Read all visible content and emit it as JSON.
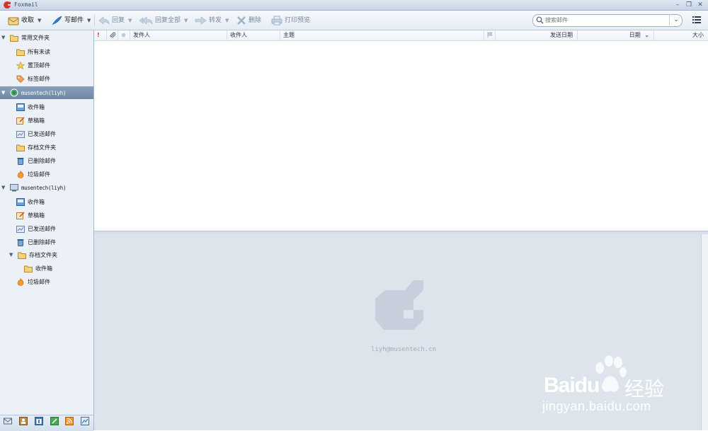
{
  "window": {
    "title": "Foxmail"
  },
  "toolbar": {
    "receive": "收取",
    "compose": "写邮件",
    "reply": "回复",
    "reply_all": "回复全部",
    "forward": "转发",
    "delete": "删除",
    "print_preview": "打印预览"
  },
  "search": {
    "placeholder": "搜索邮件"
  },
  "sidebar": {
    "common_group": {
      "label": "常用文件夹",
      "items": [
        "所有未读",
        "置顶邮件",
        "标签邮件"
      ]
    },
    "accounts": [
      {
        "label": "musentech(liyh)",
        "folders": [
          "收件箱",
          "草稿箱",
          "已发送邮件",
          "存档文件夹",
          "已删除邮件",
          "垃圾邮件"
        ]
      },
      {
        "label": "musentech(liyh)",
        "folders": [
          "收件箱",
          "草稿箱",
          "已发送邮件",
          "已删除邮件",
          "存档文件夹",
          "收件箱",
          "垃圾邮件"
        ]
      }
    ]
  },
  "list": {
    "columns": {
      "flag": "!",
      "sender": "发件人",
      "recipient": "收件人",
      "subject": "主题",
      "sent_date": "发送日期",
      "date": "日期",
      "size": "大小"
    }
  },
  "preview": {
    "email": "liyh@musentech.cn"
  },
  "watermark": {
    "brand": "Baidu",
    "brand_cn": "经验",
    "url": "jingyan.baidu.com"
  },
  "colors": {
    "accent": "#6f86a6",
    "brand_red": "#d9342b"
  }
}
